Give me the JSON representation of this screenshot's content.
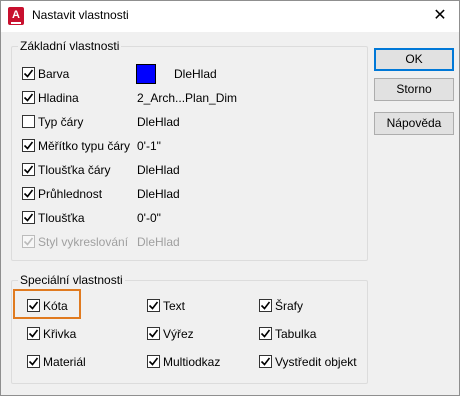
{
  "window": {
    "title": "Nastavit vlastnosti",
    "app_icon": "A",
    "close_glyph": "✕"
  },
  "basic": {
    "group_title": "Základní vlastnosti",
    "rows": [
      {
        "label": "Barva",
        "checked": true,
        "enabled": true,
        "value": "DleHlad",
        "swatch": "#0000ff"
      },
      {
        "label": "Hladina",
        "checked": true,
        "enabled": true,
        "value": "2_Arch...Plan_Dim"
      },
      {
        "label": "Typ čáry",
        "checked": false,
        "enabled": true,
        "value": "DleHlad"
      },
      {
        "label": "Měřítko typu čáry",
        "checked": true,
        "enabled": true,
        "value": "0'-1\""
      },
      {
        "label": "Tloušťka čáry",
        "checked": true,
        "enabled": true,
        "value": "DleHlad"
      },
      {
        "label": "Průhlednost",
        "checked": true,
        "enabled": true,
        "value": "DleHlad"
      },
      {
        "label": "Tloušťka",
        "checked": true,
        "enabled": true,
        "value": "0'-0\""
      },
      {
        "label": "Styl vykreslování",
        "checked": true,
        "enabled": false,
        "value": "DleHlad"
      }
    ]
  },
  "special": {
    "group_title": "Speciální vlastnosti",
    "items": [
      {
        "label": "Kóta",
        "checked": true
      },
      {
        "label": "Text",
        "checked": true
      },
      {
        "label": "Šrafy",
        "checked": true
      },
      {
        "label": "Křivka",
        "checked": true
      },
      {
        "label": "Výřez",
        "checked": true
      },
      {
        "label": "Tabulka",
        "checked": true
      },
      {
        "label": "Materiál",
        "checked": true
      },
      {
        "label": "Multiodkaz",
        "checked": true
      },
      {
        "label": "Vystředit objekt",
        "checked": true
      }
    ]
  },
  "buttons": {
    "ok": "OK",
    "cancel": "Storno",
    "help": "Nápověda"
  },
  "colors": {
    "highlight": "#e07a1f",
    "default_button_border": "#0078d7"
  }
}
